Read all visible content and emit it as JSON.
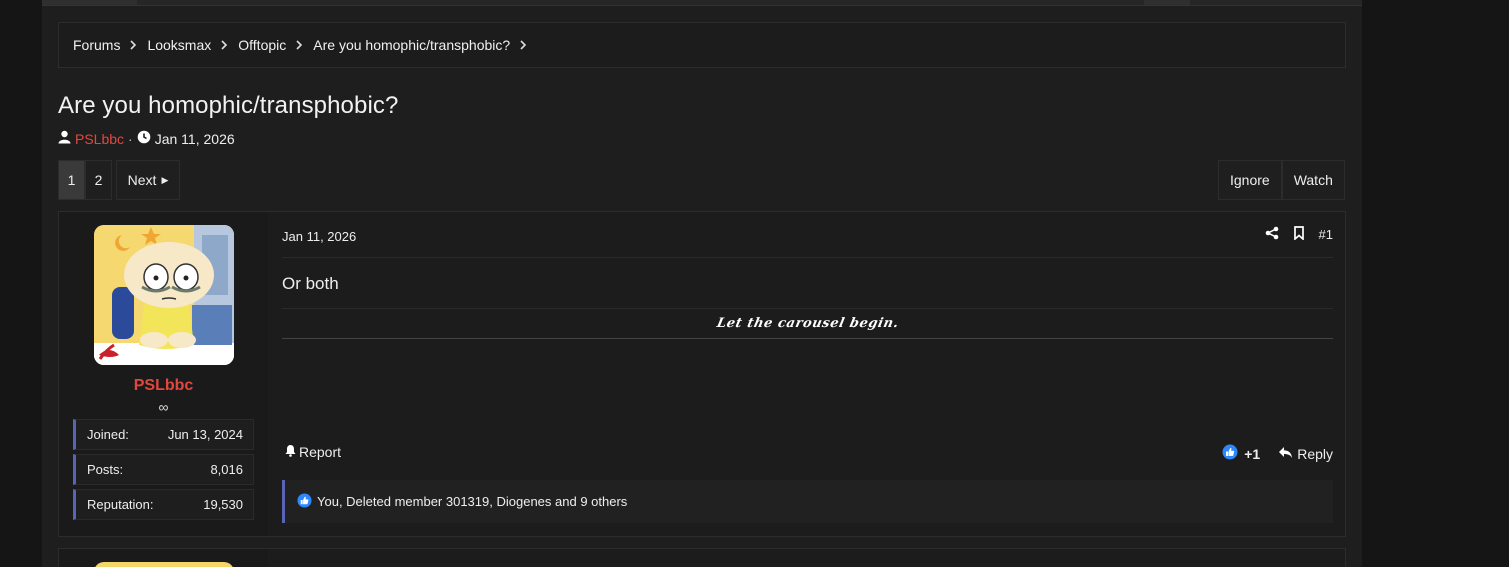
{
  "breadcrumb": {
    "items": [
      "Forums",
      "Looksmax",
      "Offtopic",
      "Are you homophic/transphobic?"
    ]
  },
  "thread": {
    "title": "Are you homophic/transphobic?",
    "author": "PSLbbc",
    "separator": "·",
    "date": "Jan 11, 2026"
  },
  "pagination": {
    "pages": [
      "1",
      "2"
    ],
    "current": "1",
    "next_label": "Next"
  },
  "thread_actions": {
    "ignore_label": "Ignore",
    "watch_label": "Watch"
  },
  "post": {
    "date": "Jan 11, 2026",
    "number": "#1",
    "body": "Or both",
    "signature": "Let the carousel begin.",
    "report_label": "Report",
    "reaction_count": "+1",
    "reply_label": "Reply",
    "likes_text": "You, Deleted member 301319, Diogenes and 9 others"
  },
  "user": {
    "name": "PSLbbc",
    "title": "∞",
    "stats": [
      {
        "label": "Joined:",
        "value": "Jun 13, 2024"
      },
      {
        "label": "Posts:",
        "value": "8,016"
      },
      {
        "label": "Reputation:",
        "value": "19,530"
      }
    ]
  },
  "colors": {
    "accent_user": "#e0483e",
    "stat_border": "#5865b6",
    "like_blue": "#2d88ff"
  }
}
